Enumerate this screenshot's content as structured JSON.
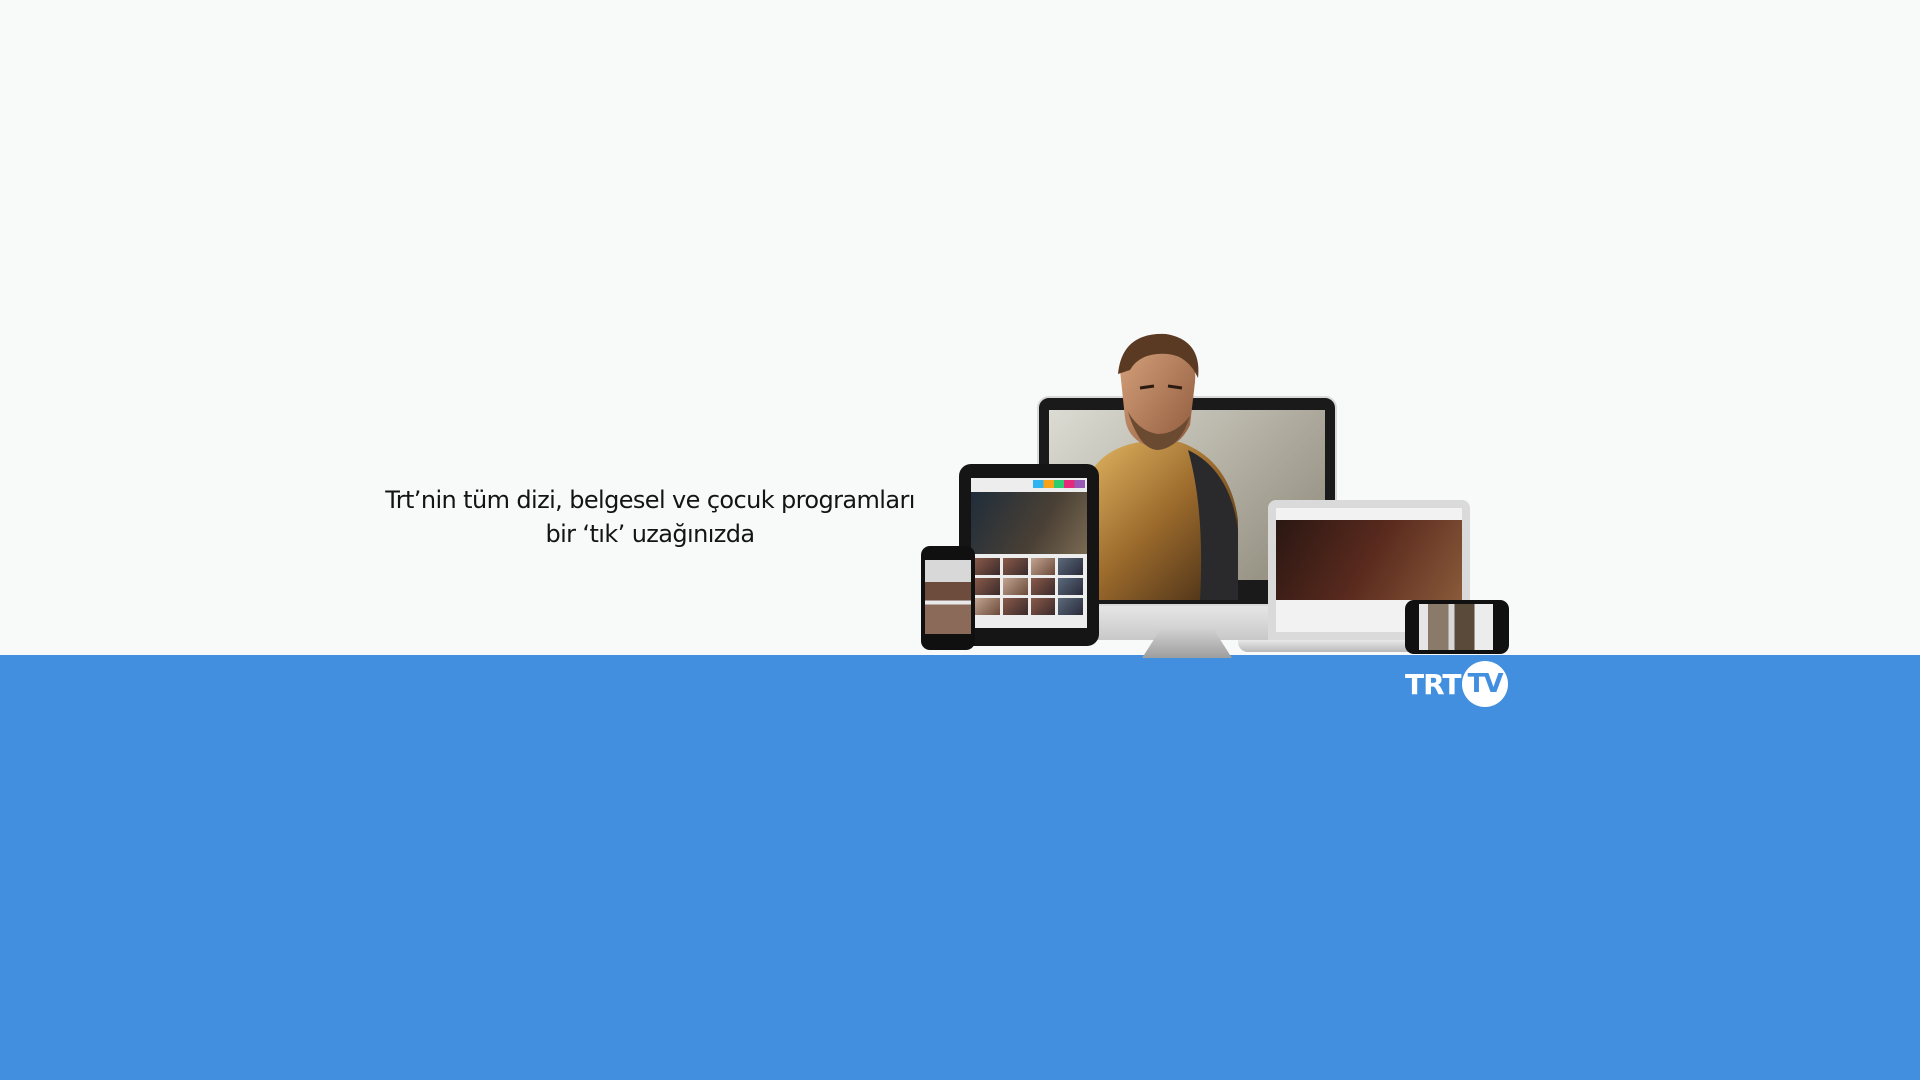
{
  "banner": {
    "tagline_line1": "Trt’nin tüm dizi, belgesel ve çocuk programları",
    "tagline_line2": "bir ‘tık’ uzağınızda"
  },
  "logo": {
    "part1": "TRT",
    "part2": "TV"
  },
  "colors": {
    "top_background": "#f8f9f9",
    "bottom_background": "#428fe0",
    "text": "#141414",
    "logo": "#ffffff"
  },
  "icons": {
    "devices": "devices-illustration",
    "brand": "trt-tv-logo"
  }
}
